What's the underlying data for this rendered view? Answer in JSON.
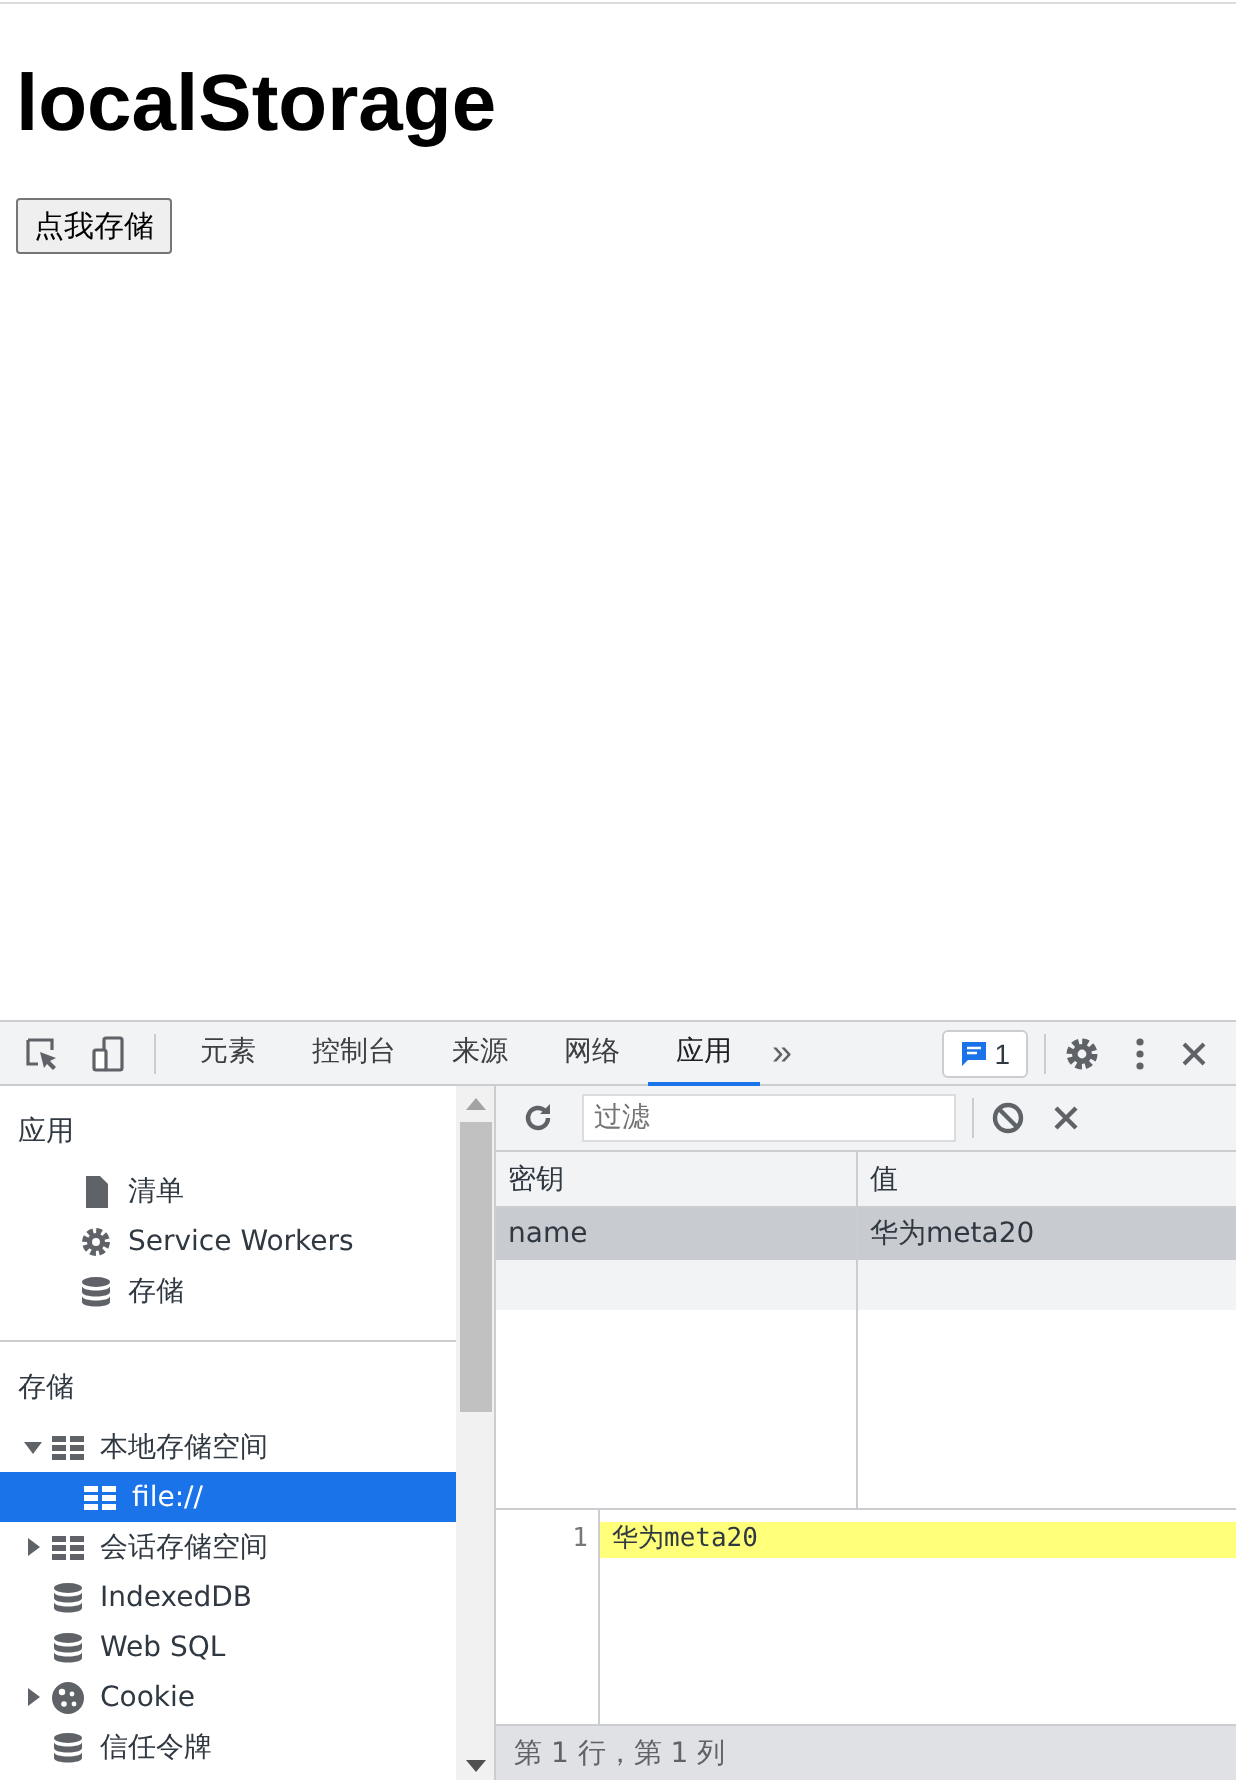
{
  "page": {
    "heading": "localStorage",
    "button": "点我存储"
  },
  "devtools": {
    "tabs": [
      {
        "label": "元素",
        "selected": false
      },
      {
        "label": "控制台",
        "selected": false
      },
      {
        "label": "来源",
        "selected": false
      },
      {
        "label": "网络",
        "selected": false
      },
      {
        "label": "应用",
        "selected": true
      }
    ],
    "more": "»",
    "issues_badge": "1",
    "sidebar": {
      "sections": [
        {
          "title": "应用",
          "items": [
            {
              "label": "清单",
              "kind": "file",
              "selected": false
            },
            {
              "label": "Service Workers",
              "kind": "gear",
              "selected": false
            },
            {
              "label": "存储",
              "kind": "database",
              "selected": false
            }
          ]
        },
        {
          "title": "存储",
          "items": [
            {
              "label": "本地存储空间",
              "kind": "table",
              "expanded": true,
              "selected": false,
              "children": [
                {
                  "label": "file://",
                  "kind": "table",
                  "selected": true
                }
              ]
            },
            {
              "label": "会话存储空间",
              "kind": "table",
              "expanded": false,
              "selected": false
            },
            {
              "label": "IndexedDB",
              "kind": "database",
              "selected": false
            },
            {
              "label": "Web SQL",
              "kind": "database",
              "selected": false
            },
            {
              "label": "Cookie",
              "kind": "cookie",
              "expanded": false,
              "selected": false
            },
            {
              "label": "信任令牌",
              "kind": "database",
              "selected": false
            }
          ]
        }
      ]
    },
    "filter": {
      "placeholder": "过滤"
    },
    "table": {
      "columns": [
        "密钥",
        "值"
      ],
      "rows": [
        {
          "key": "name",
          "value": "华为meta20",
          "selected": true
        }
      ]
    },
    "preview": {
      "lines": [
        {
          "number": "1",
          "text": "华为meta20",
          "highlighted": true
        }
      ]
    },
    "status_bar": "第 1 行，第 1 列"
  }
}
